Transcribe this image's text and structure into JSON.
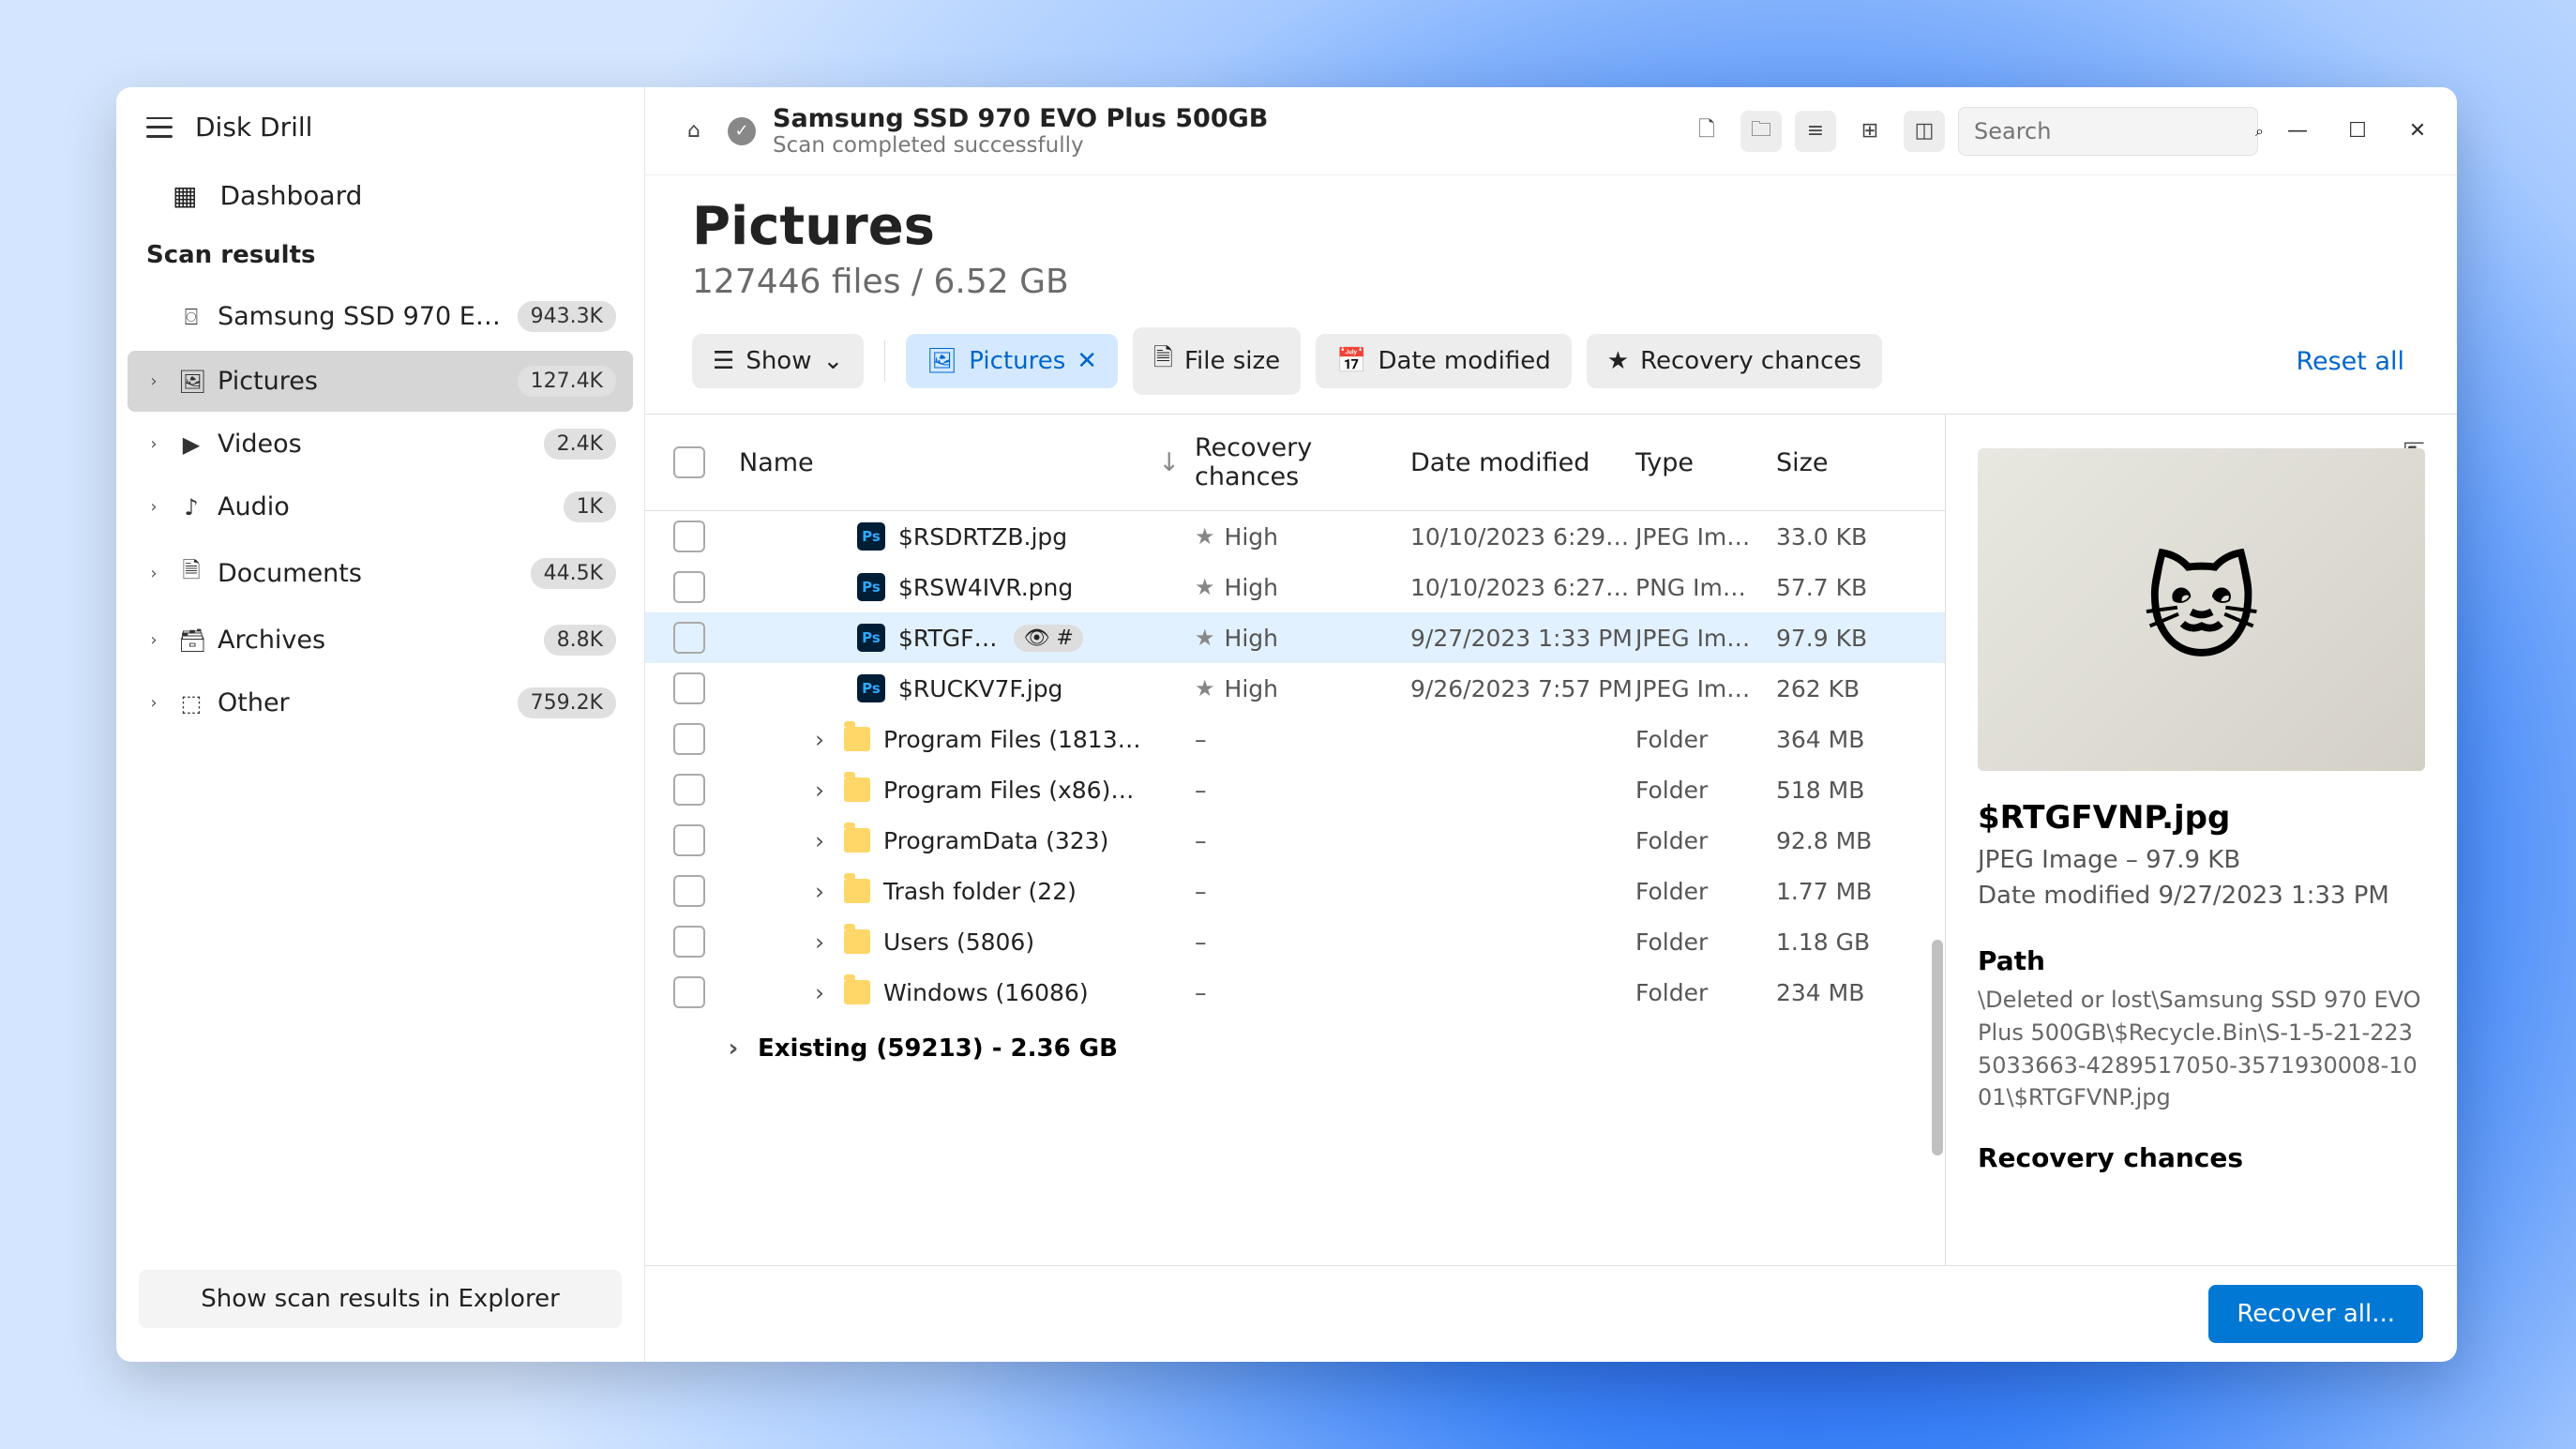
{
  "app_title": "Disk Drill",
  "sidebar": {
    "dashboard": "Dashboard",
    "section": "Scan results",
    "drive": {
      "label": "Samsung SSD 970 EV...",
      "count": "943.3K"
    },
    "items": [
      {
        "label": "Pictures",
        "count": "127.4K"
      },
      {
        "label": "Videos",
        "count": "2.4K"
      },
      {
        "label": "Audio",
        "count": "1K"
      },
      {
        "label": "Documents",
        "count": "44.5K"
      },
      {
        "label": "Archives",
        "count": "8.8K"
      },
      {
        "label": "Other",
        "count": "759.2K"
      }
    ],
    "show_explorer": "Show scan results in Explorer"
  },
  "topbar": {
    "disk_title": "Samsung SSD 970 EVO Plus 500GB",
    "disk_status": "Scan completed successfully",
    "search_placeholder": "Search"
  },
  "header": {
    "title": "Pictures",
    "subtitle": "127446 files / 6.52 GB"
  },
  "filters": {
    "show": "Show",
    "pictures": "Pictures",
    "file_size": "File size",
    "date_modified": "Date modified",
    "recovery_chances": "Recovery chances",
    "reset": "Reset all"
  },
  "columns": {
    "name": "Name",
    "recovery": "Recovery chances",
    "date": "Date modified",
    "type": "Type",
    "size": "Size"
  },
  "rows": [
    {
      "name": "$RSDRTZB.jpg",
      "rec": "High",
      "date": "10/10/2023 6:29…",
      "type": "JPEG Im…",
      "size": "33.0 KB",
      "kind": "file"
    },
    {
      "name": "$RSW4IVR.png",
      "rec": "High",
      "date": "10/10/2023 6:27…",
      "type": "PNG Im…",
      "size": "57.7 KB",
      "kind": "file"
    },
    {
      "name": "$RTGF…",
      "rec": "High",
      "date": "9/27/2023 1:33 PM",
      "type": "JPEG Im…",
      "size": "97.9 KB",
      "kind": "file",
      "sel": true,
      "eye": true
    },
    {
      "name": "$RUCKV7F.jpg",
      "rec": "High",
      "date": "9/26/2023 7:57 PM",
      "type": "JPEG Im…",
      "size": "262 KB",
      "kind": "file"
    },
    {
      "name": "Program Files (1813…",
      "rec": "–",
      "date": "",
      "type": "Folder",
      "size": "364 MB",
      "kind": "folder"
    },
    {
      "name": "Program Files (x86)…",
      "rec": "–",
      "date": "",
      "type": "Folder",
      "size": "518 MB",
      "kind": "folder"
    },
    {
      "name": "ProgramData (323)",
      "rec": "–",
      "date": "",
      "type": "Folder",
      "size": "92.8 MB",
      "kind": "folder"
    },
    {
      "name": "Trash folder (22)",
      "rec": "–",
      "date": "",
      "type": "Folder",
      "size": "1.77 MB",
      "kind": "folder"
    },
    {
      "name": "Users (5806)",
      "rec": "–",
      "date": "",
      "type": "Folder",
      "size": "1.18 GB",
      "kind": "folder"
    },
    {
      "name": "Windows (16086)",
      "rec": "–",
      "date": "",
      "type": "Folder",
      "size": "234 MB",
      "kind": "folder"
    }
  ],
  "existing": "Existing (59213) - 2.36 GB",
  "detail": {
    "filename": "$RTGFVNP.jpg",
    "meta": "JPEG Image – 97.9 KB",
    "modified": "Date modified 9/27/2023 1:33 PM",
    "path_label": "Path",
    "path": "\\Deleted or lost\\Samsung SSD 970 EVO Plus 500GB\\$Recycle.Bin\\S-1-5-21-2235033663-4289517050-3571930008-1001\\$RTGFVNP.jpg",
    "rec_label": "Recovery chances"
  },
  "recover_button": "Recover all..."
}
